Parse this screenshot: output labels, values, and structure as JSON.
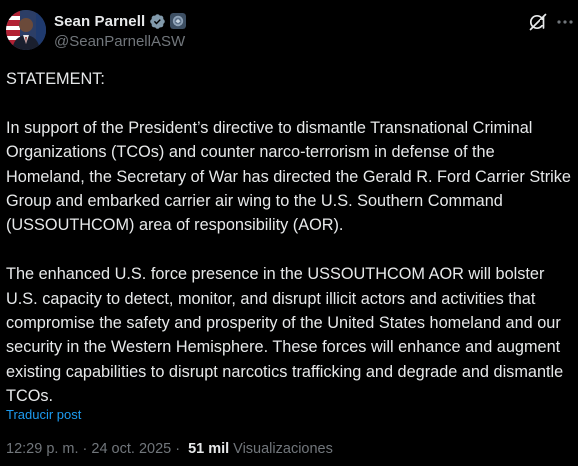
{
  "author": {
    "display_name": "Sean Parnell",
    "handle": "@SeanParnellASW",
    "avatar_icon": "person-avatar",
    "verified_icon": "verified-badge-icon",
    "affiliation_icon": "government-affiliation-badge-icon"
  },
  "post": {
    "paragraphs": [
      "STATEMENT:",
      "In support of the President’s directive to dismantle Transnational Criminal Organizations (TCOs) and counter narco-terrorism in defense of the Homeland, the Secretary of War has directed the Gerald R. Ford Carrier Strike Group and embarked carrier air wing to the U.S. Southern Command (USSOUTHCOM) area of responsibility (AOR).",
      "The enhanced U.S. force presence in the USSOUTHCOM AOR will bolster U.S. capacity to detect, monitor, and disrupt illicit actors and activities that compromise the safety and prosperity of the United States homeland and our security in the Western Hemisphere. These forces will enhance and augment existing capabilities to disrupt narcotics trafficking and degrade and dismantle TCOs."
    ],
    "translate_label": "Traducir post"
  },
  "meta": {
    "time": "12:29 p. m.",
    "separator": "·",
    "date": "24 oct. 2025",
    "views_count": "51 mil",
    "views_label": "Visualizaciones"
  },
  "colors": {
    "background": "#000000",
    "text": "#e7e9ea",
    "muted": "#71767b",
    "link": "#1d9bf0"
  }
}
